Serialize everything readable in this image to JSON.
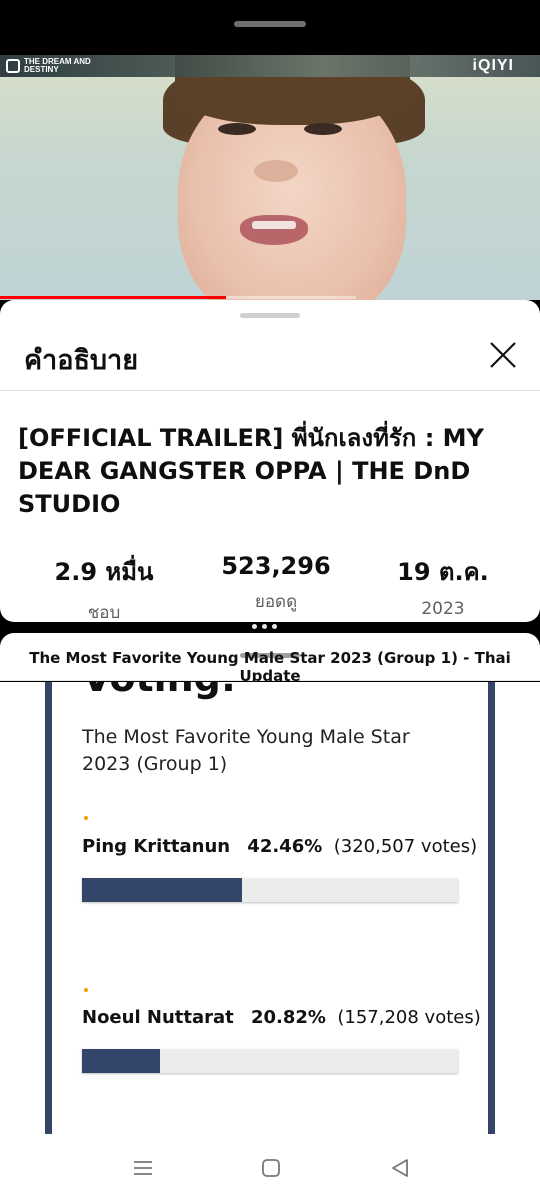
{
  "video": {
    "brand_logo_text": "THE DREAM AND DESTINY",
    "platform_logo_text": "iQIYI",
    "progress": 0.635
  },
  "description_sheet": {
    "title": "คำอธิบาย",
    "video_title": "[OFFICIAL TRAILER] พี่นักเลงที่รัก : MY DEAR GANGSTER OPPA | THE DnD STUDIO",
    "stats": [
      {
        "value": "2.9 หมื่น",
        "label": "ชอบ"
      },
      {
        "value": "523,296",
        "label": "ยอดดู"
      },
      {
        "value": "19 ต.ค.",
        "label": "2023"
      }
    ]
  },
  "web_popup": {
    "page_title": "The Most Favorite Young Male Star 2023 (Group 1) - Thai Update",
    "heading_partial": "Voting:",
    "poll_title": "The Most Favorite Young Male Star 2023 (Group 1)",
    "candidates": [
      {
        "name": "Ping Krittanun",
        "percent": "42.46%",
        "votes": "(320,507 votes)",
        "share": 0.4246
      },
      {
        "name": "Noeul Nuttarat",
        "percent": "20.82%",
        "votes": "(157,208 votes)",
        "share": 0.2082
      }
    ]
  },
  "colors": {
    "progress": "#ff0000",
    "poll_bar": "#34456a",
    "bullet": "#f0a000"
  },
  "nav": {
    "icons": [
      "recent-apps-icon",
      "home-icon",
      "back-icon"
    ]
  }
}
